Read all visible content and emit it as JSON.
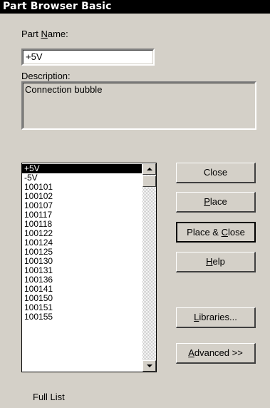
{
  "window": {
    "title": "Part Browser Basic"
  },
  "part_name": {
    "label_before": "Part ",
    "label_accel": "N",
    "label_after": "ame:",
    "value": "+5V"
  },
  "description": {
    "label": "Description:",
    "value": "Connection bubble"
  },
  "parts_list": {
    "items": [
      "+5V",
      "-5V",
      "100101",
      "100102",
      "100107",
      "100117",
      "100118",
      "100122",
      "100124",
      "100125",
      "100130",
      "100131",
      "100136",
      "100141",
      "100150",
      "100151",
      "100155"
    ],
    "selected": "+5V"
  },
  "buttons": {
    "close": {
      "before": "Close",
      "accel": "",
      "after": ""
    },
    "place": {
      "before": "",
      "accel": "P",
      "after": "lace"
    },
    "place_close": {
      "before": "Place & ",
      "accel": "C",
      "after": "lose"
    },
    "help": {
      "before": "",
      "accel": "H",
      "after": "elp"
    },
    "libraries": {
      "before": "",
      "accel": "L",
      "after": "ibraries..."
    },
    "advanced": {
      "before": "",
      "accel": "A",
      "after": "dvanced >>"
    }
  },
  "footer": {
    "list_mode": "Full List"
  },
  "icons": {
    "scroll_up": "scroll-up-arrow-icon",
    "scroll_down": "scroll-down-arrow-icon"
  },
  "colors": {
    "face": "#d4d0c8",
    "title_bg": "#000000",
    "selection": "#000000"
  }
}
